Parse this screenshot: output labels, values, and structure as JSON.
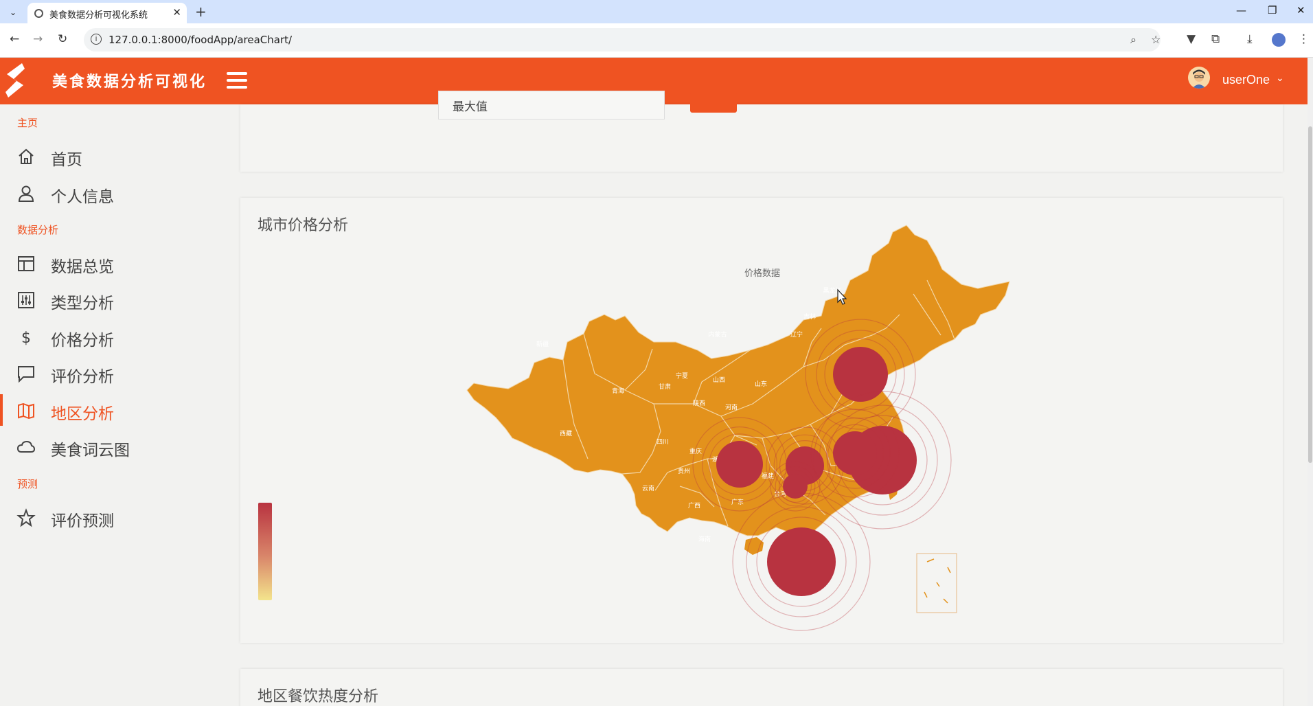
{
  "browser": {
    "tab_title": "美食数据分析可视化系统",
    "url": "127.0.0.1:8000/foodApp/areaChart/"
  },
  "header": {
    "app_title": "美食数据分析可视化",
    "user_name": "userOne"
  },
  "sidebar": {
    "sections": [
      {
        "label": "主页",
        "items": [
          {
            "label": "首页",
            "icon": "home-icon"
          },
          {
            "label": "个人信息",
            "icon": "user-icon"
          }
        ]
      },
      {
        "label": "数据分析",
        "items": [
          {
            "label": "数据总览",
            "icon": "layout-icon"
          },
          {
            "label": "类型分析",
            "icon": "sliders-icon"
          },
          {
            "label": "价格分析",
            "icon": "dollar-icon"
          },
          {
            "label": "评价分析",
            "icon": "comment-icon"
          },
          {
            "label": "地区分析",
            "icon": "map-icon",
            "active": true
          },
          {
            "label": "美食词云图",
            "icon": "cloud-icon"
          }
        ]
      },
      {
        "label": "预测",
        "items": [
          {
            "label": "评价预测",
            "icon": "star-icon"
          }
        ]
      }
    ]
  },
  "filter": {
    "selected_value": "最大值"
  },
  "map_card": {
    "title": "城市价格分析"
  },
  "bottom_card": {
    "title": "地区餐饮热度分析"
  },
  "chart_data": {
    "type": "effect-scatter-map",
    "title": "价格数据",
    "map": "china",
    "province_labels": [
      "新疆",
      "西藏",
      "青海",
      "甘肃",
      "宁夏",
      "内蒙古",
      "黑龙江",
      "吉林",
      "辽宁",
      "山西",
      "陕西",
      "河南",
      "山东",
      "四川",
      "重庆",
      "贵州",
      "云南",
      "广西",
      "广东",
      "湖南",
      "江西",
      "福建",
      "海南",
      "台湾"
    ],
    "bubbles": [
      {
        "location": "北京"
      },
      {
        "location": "成都"
      },
      {
        "location": "武汉"
      },
      {
        "location": "长沙"
      },
      {
        "location": "上海"
      },
      {
        "location": "江苏"
      },
      {
        "location": "广州"
      }
    ],
    "visual_map": {
      "orient": "vertical",
      "colors": [
        "#f5e58a",
        "#d37764",
        "#b83340"
      ]
    },
    "colors": {
      "land": "#e3921c",
      "bubble": "#b83340",
      "ripple": "#b83340"
    }
  },
  "colors": {
    "accent": "#ef5322"
  }
}
